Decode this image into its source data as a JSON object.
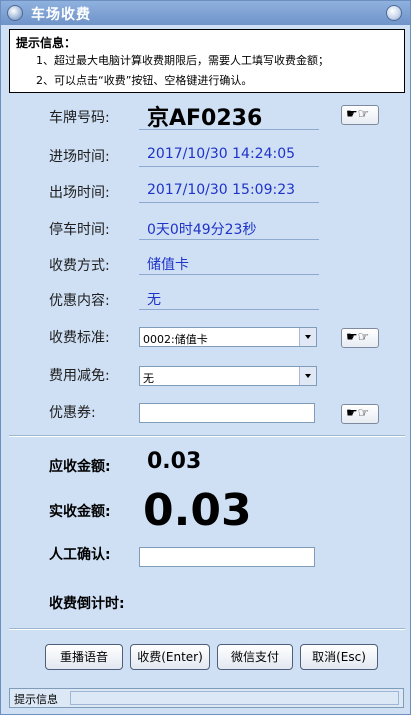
{
  "window": {
    "title": "车场收费"
  },
  "hint": {
    "title": "提示信息：",
    "lines": [
      "1、超过最大电脑计算收费期限后，需要人工填写收费金额；",
      "2、可以点击“收费”按钮、空格键进行确认。"
    ]
  },
  "fields": {
    "plate": {
      "label": "车牌号码:",
      "value": "京AF0236"
    },
    "entry_time": {
      "label": "进场时间:",
      "value": "2017/10/30 14:24:05"
    },
    "exit_time": {
      "label": "出场时间:",
      "value": "2017/10/30 15:09:23"
    },
    "parking_time": {
      "label": "停车时间:",
      "value": "0天0时49分23秒"
    },
    "payment_method": {
      "label": "收费方式:",
      "value": "储值卡"
    },
    "discount_content": {
      "label": "优惠内容:",
      "value": "无"
    },
    "fee_standard": {
      "label": "收费标准:",
      "value": "0002:储值卡"
    },
    "fee_reduction": {
      "label": "费用减免:",
      "value": "无"
    },
    "coupon": {
      "label": "优惠券:",
      "value": ""
    }
  },
  "amounts": {
    "receivable": {
      "label": "应收金额:",
      "value": "0.03"
    },
    "actual": {
      "label": "实收金额:",
      "value": "0.03"
    },
    "manual_confirm": {
      "label": "人工确认:",
      "value": ""
    },
    "countdown": {
      "label": "收费倒计时:"
    }
  },
  "buttons": {
    "replay_voice": "重播语音",
    "charge": "收费(Enter)",
    "wechat_pay": "微信支付",
    "cancel": "取消(Esc)"
  },
  "status": {
    "label": "提示信息",
    "value": ""
  },
  "icons": {
    "hand": "☛☞"
  },
  "colors": {
    "window_bg": "#cfe0f5",
    "title_bar": "#7a9dd0",
    "value_text": "#1f33c8"
  }
}
